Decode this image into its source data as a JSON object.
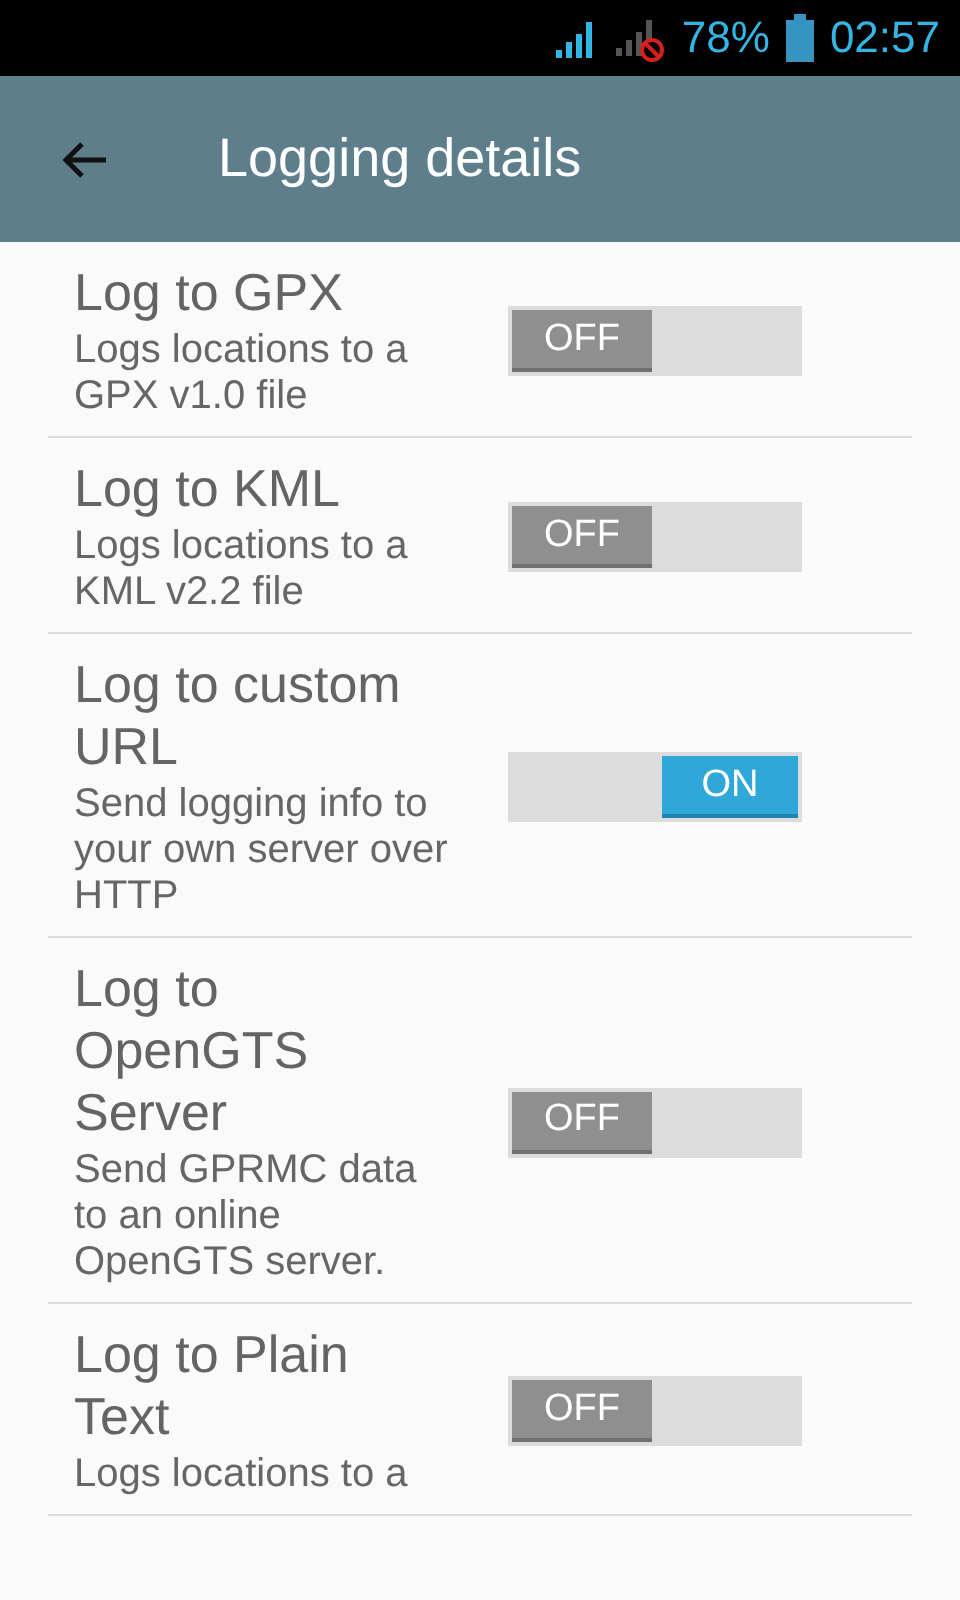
{
  "status_bar": {
    "battery": "78%",
    "time": "02:57"
  },
  "app_bar": {
    "title": "Logging details"
  },
  "settings": [
    {
      "title": "Log to GPX",
      "summary": "Logs locations to a GPX v1.0 file",
      "on": false,
      "switch_label": "OFF"
    },
    {
      "title": "Log to KML",
      "summary": "Logs locations to a KML v2.2 file",
      "on": false,
      "switch_label": "OFF"
    },
    {
      "title": "Log to custom URL",
      "summary": "Send logging info to your own server over HTTP",
      "on": true,
      "switch_label": "ON"
    },
    {
      "title": "Log to OpenGTS Server",
      "summary": "Send GPRMC data to an online OpenGTS server.",
      "on": false,
      "switch_label": "OFF"
    },
    {
      "title": "Log to Plain Text",
      "summary": "Logs locations to a",
      "on": false,
      "switch_label": "OFF"
    }
  ]
}
